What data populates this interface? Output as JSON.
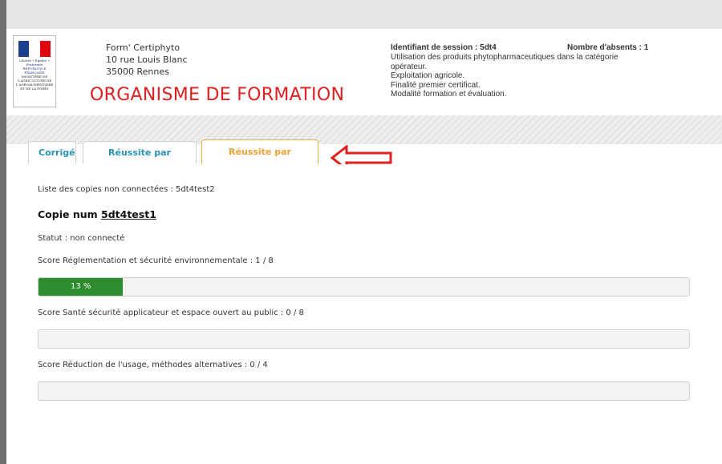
{
  "header": {
    "logo": {
      "republic_text": "Liberté • Égalité • Fraternité RÉPUBLIQUE FRANÇAISE",
      "ministry_text": "MINISTÈRE DE L'AGRICULTURE DE L'AGROALIMENTAIRE ET DE LA FORÊT"
    },
    "org_name": "Form' Certiphyto",
    "org_street": "10 rue Louis Blanc",
    "org_city": "35000 Rennes",
    "org_title": "ORGANISME DE FORMATION",
    "session_id_label": "Identifiant de session : 5dt4",
    "absents_label": "Nombre d'absents : 1",
    "session_lines": [
      "Utilisation des produits phytopharmaceutiques dans la catégorie",
      "opérateur.",
      "Exploitation agricole.",
      "Finalité premier certificat.",
      "Modalité formation et évaluation."
    ]
  },
  "tabs": [
    {
      "label": "Corrigé",
      "active": false
    },
    {
      "label": "Réussite par question",
      "active": false
    },
    {
      "label": "Réussite par candidat",
      "active": true
    }
  ],
  "content": {
    "unconnected_list": "Liste des copies non connectées : 5dt4test2",
    "copy_prefix": "Copie num",
    "copy_num": "5dt4test1",
    "status": "Statut : non connecté",
    "scores": [
      {
        "label": "Score Réglementation et sécurité environnementale : 1 / 8",
        "percent": 13,
        "percent_text": "13 %"
      },
      {
        "label": "Score Santé sécurité applicateur et espace ouvert au public : 0 / 8",
        "percent": 0,
        "percent_text": ""
      },
      {
        "label": "Score Réduction de l'usage, méthodes alternatives : 0 / 4",
        "percent": 0,
        "percent_text": ""
      }
    ]
  },
  "colors": {
    "accent_tab": "#2a92b4",
    "active_tab": "#f0a030",
    "title_red": "#e02020",
    "progress_green": "#2e8b2e",
    "arrow_red": "#e0201c"
  },
  "icons": {
    "annotation": "red-outline-arrow-left"
  }
}
